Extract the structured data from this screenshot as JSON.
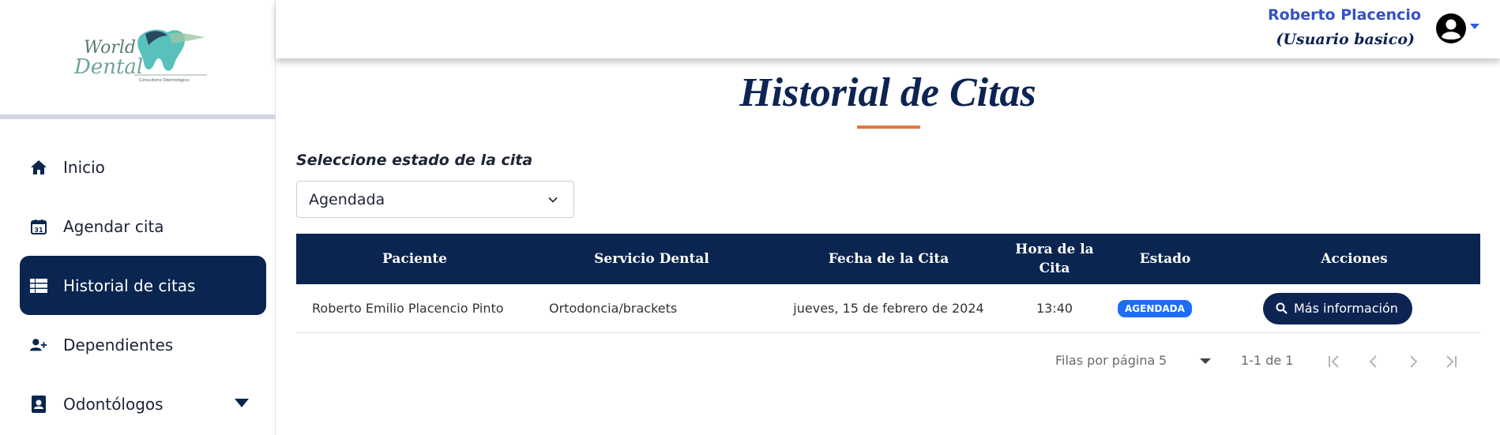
{
  "logo": {
    "line1": "World",
    "line2": "Dental",
    "tagline": "Consultorio Odontológico"
  },
  "sidebar": {
    "items": [
      {
        "label": "Inicio",
        "icon": "home-icon"
      },
      {
        "label": "Agendar cita",
        "icon": "calendar-icon",
        "icon_text": "31"
      },
      {
        "label": "Historial de citas",
        "icon": "list-icon",
        "active": true
      },
      {
        "label": "Dependientes",
        "icon": "user-plus-icon"
      },
      {
        "label": "Odontólogos",
        "icon": "doctor-badge-icon",
        "has_dropdown": true
      }
    ]
  },
  "header": {
    "user_name": "Roberto Placencio",
    "user_role": "(Usuario basico)"
  },
  "main": {
    "title": "Historial de Citas",
    "filter_label": "Seleccione estado de la cita",
    "filter_value": "Agendada"
  },
  "table": {
    "headers": [
      "Paciente",
      "Servicio Dental",
      "Fecha de la Cita",
      "Hora de la Cita",
      "Estado",
      "Acciones"
    ],
    "rows": [
      {
        "paciente": "Roberto Emilio Placencio Pinto",
        "servicio": "Ortodoncia/brackets",
        "fecha": "jueves, 15 de febrero de 2024",
        "hora": "13:40",
        "estado": "AGENDADA",
        "accion": "Más información"
      }
    ]
  },
  "pagination": {
    "rows_label": "Filas por página",
    "rows_value": "5",
    "range": "1-1 de 1"
  },
  "colors": {
    "navy": "#0a2550",
    "accent_orange": "#e4773b",
    "badge_blue": "#1d6ef5",
    "user_blue": "#3450c8"
  }
}
